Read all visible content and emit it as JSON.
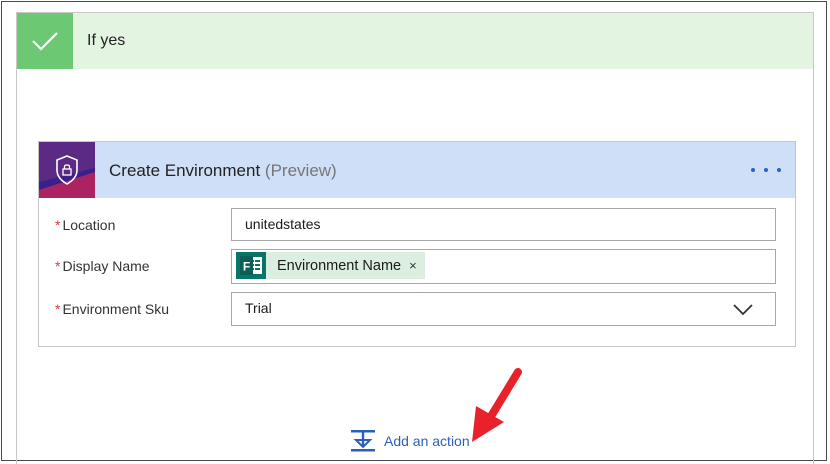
{
  "condition_branch": {
    "title": "If yes",
    "accent_color": "#6cc872",
    "header_bg": "#e3f4e1",
    "icon": "checkmark-icon"
  },
  "action_card": {
    "title": "Create Environment",
    "title_suffix": "(Preview)",
    "header_bg": "#cfdff7",
    "icon": "shield-lock-icon",
    "more_icon": "ellipsis-icon",
    "fields": [
      {
        "label": "Location",
        "required": "*",
        "value": "unitedstates",
        "type": "text"
      },
      {
        "label": "Display Name",
        "required": "*",
        "token": {
          "label": "Environment Name",
          "icon": "microsoft-forms-icon",
          "remove": "×"
        },
        "type": "token"
      },
      {
        "label": "Environment Sku",
        "required": "*",
        "value": "Trial",
        "type": "dropdown",
        "chevron_icon": "chevron-down-icon"
      }
    ]
  },
  "add_action": {
    "label": "Add an action",
    "icon": "add-action-icon",
    "link_color": "#2b5fb8"
  },
  "annotation": {
    "icon": "red-arrow-icon",
    "color": "#e8212a"
  }
}
